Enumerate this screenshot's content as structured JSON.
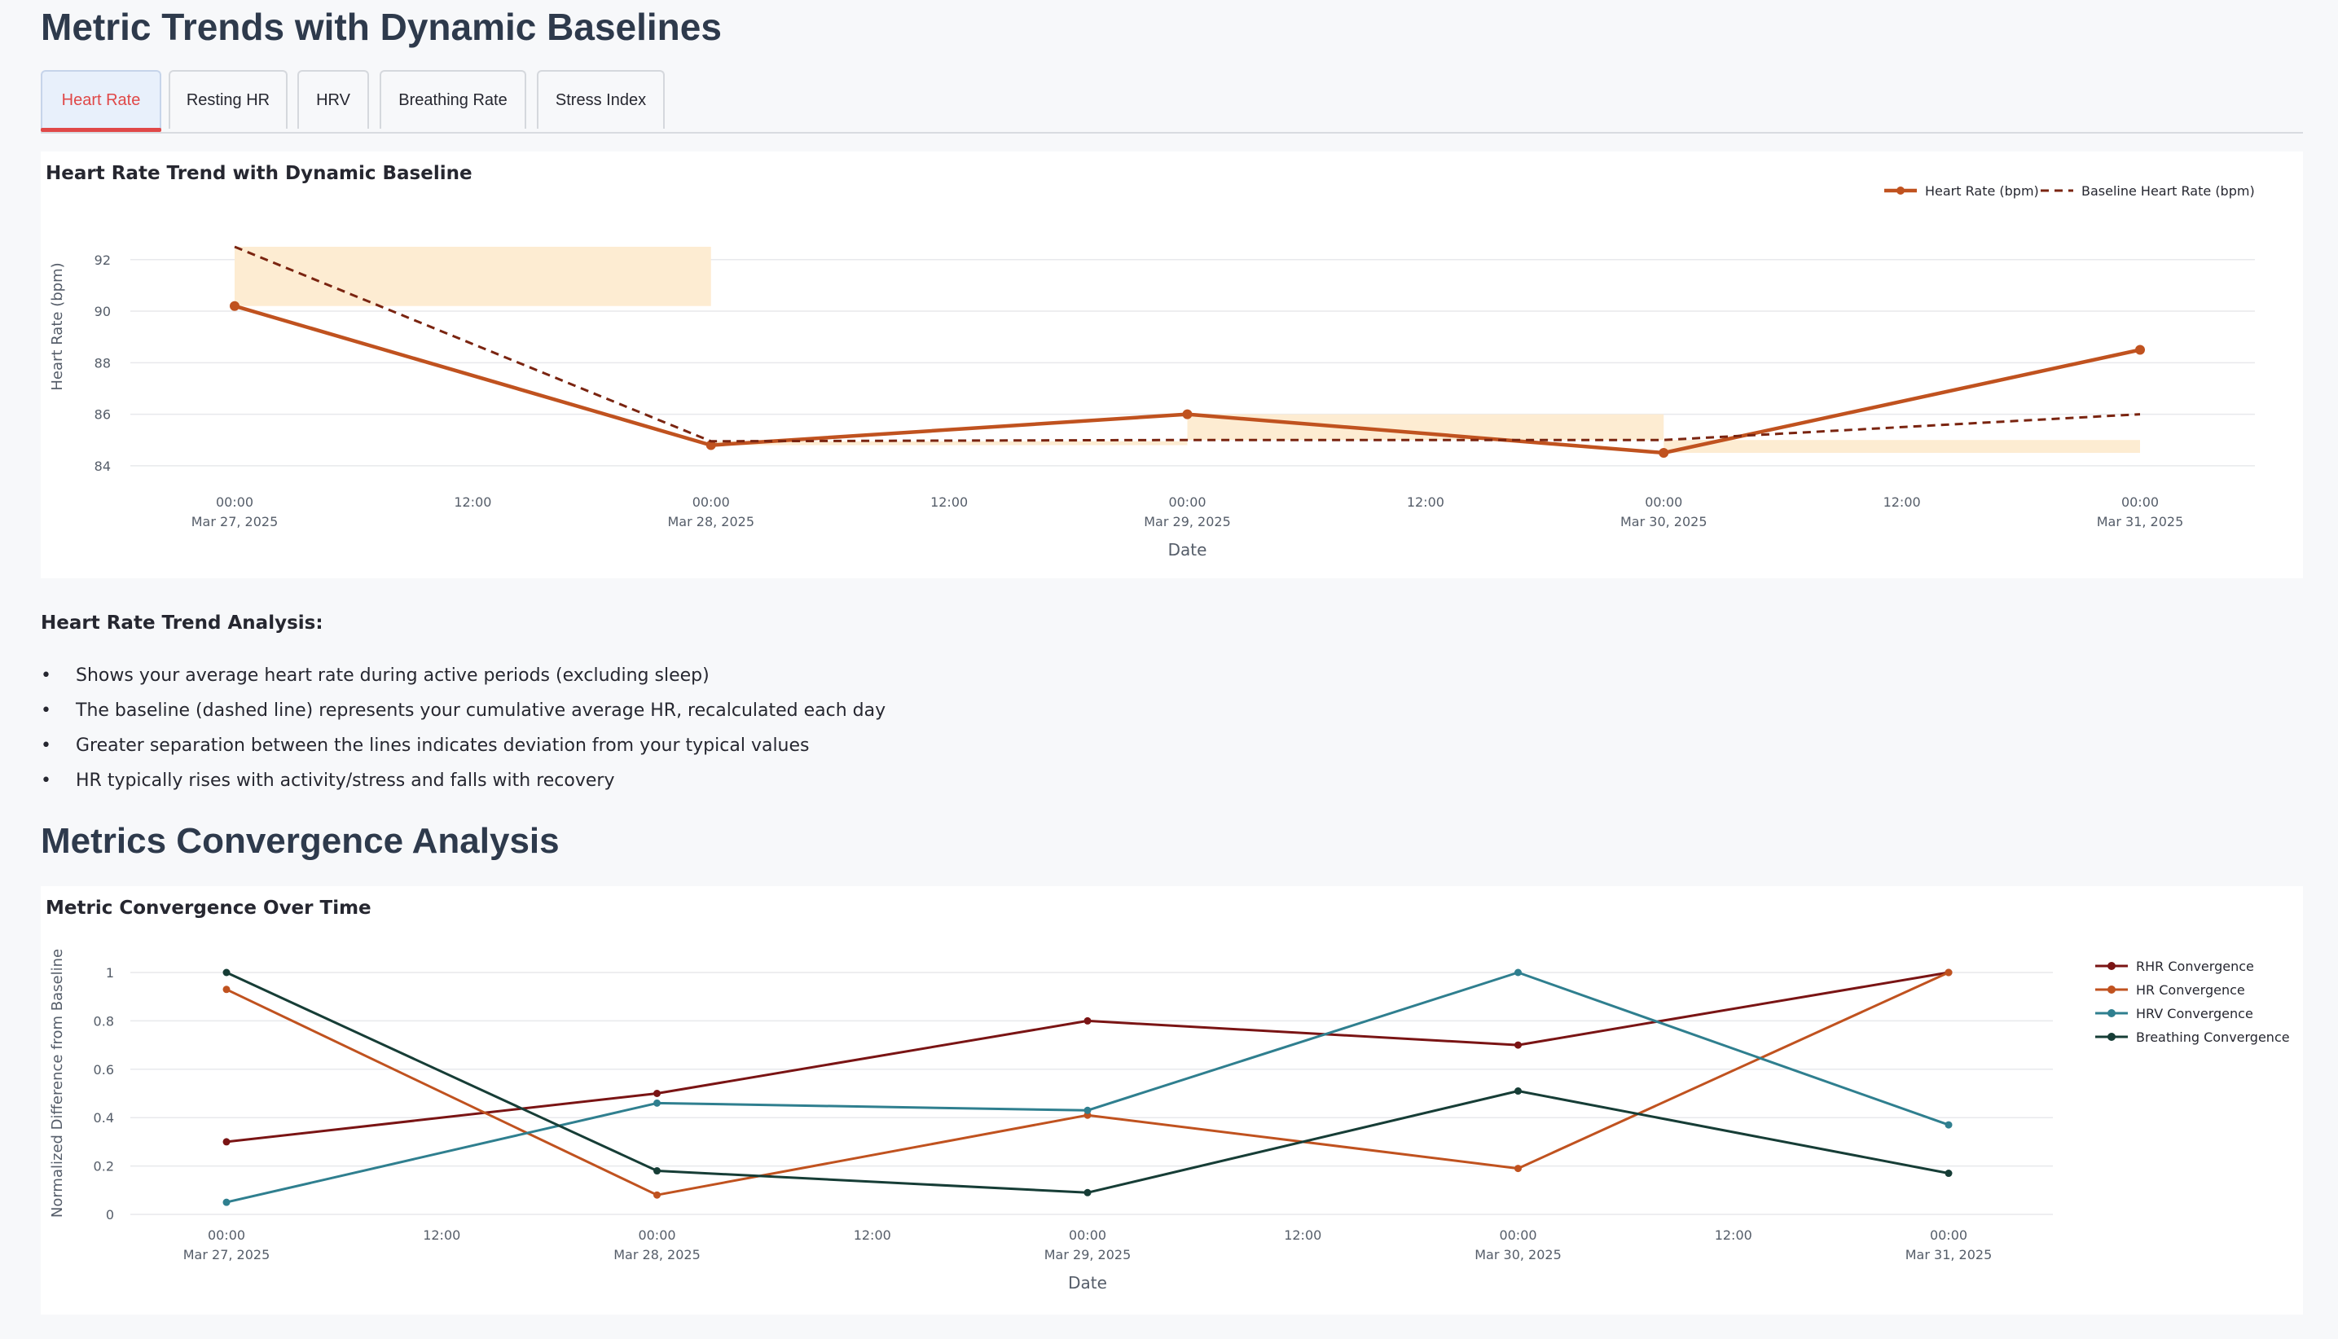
{
  "page": {
    "title": "Metric Trends with Dynamic Baselines",
    "tabs": [
      {
        "label": "Heart Rate",
        "active": true
      },
      {
        "label": "Resting HR",
        "active": false
      },
      {
        "label": "HRV",
        "active": false
      },
      {
        "label": "Breathing Rate",
        "active": false
      },
      {
        "label": "Stress Index",
        "active": false
      }
    ],
    "analysis_title": "Heart Rate Trend Analysis:",
    "analysis_points": [
      "Shows your average heart rate during active periods (excluding sleep)",
      "The baseline (dashed line) represents your cumulative average HR, recalculated each day",
      "Greater separation between the lines indicates deviation from your typical values",
      "HR typically rises with activity/stress and falls with recovery"
    ],
    "section2_title": "Metrics Convergence Analysis",
    "colors": {
      "accent": "#e04848",
      "heading": "#2e3a4c",
      "hr": "#c0521f",
      "baseline": "#7a2410",
      "band": "#fdecd2"
    }
  },
  "chart_data": [
    {
      "type": "line",
      "title": "Heart Rate Trend with Dynamic Baseline",
      "xlabel": "Date",
      "ylabel": "Heart Rate (bpm)",
      "x": [
        "2025-03-27",
        "2025-03-28",
        "2025-03-29",
        "2025-03-30",
        "2025-03-31"
      ],
      "x_ticks": [
        {
          "time": "00:00",
          "date": "Mar 27, 2025"
        },
        {
          "time": "12:00",
          "date": ""
        },
        {
          "time": "00:00",
          "date": "Mar 28, 2025"
        },
        {
          "time": "12:00",
          "date": ""
        },
        {
          "time": "00:00",
          "date": "Mar 29, 2025"
        },
        {
          "time": "12:00",
          "date": ""
        },
        {
          "time": "00:00",
          "date": "Mar 30, 2025"
        },
        {
          "time": "12:00",
          "date": ""
        },
        {
          "time": "00:00",
          "date": "Mar 31, 2025"
        }
      ],
      "y_ticks": [
        84,
        86,
        88,
        90,
        92
      ],
      "ylim": [
        83.3,
        93.1
      ],
      "grid": true,
      "legend_position": "top-right",
      "series": [
        {
          "name": "Heart Rate (bpm)",
          "values": [
            90.2,
            84.8,
            86.0,
            84.5,
            88.5
          ],
          "color": "#c0521f",
          "style": "solid",
          "markers": true
        },
        {
          "name": "Baseline Heart Rate (bpm)",
          "values": [
            92.5,
            84.95,
            85.0,
            85.0,
            86.0
          ],
          "color": "#7a2410",
          "style": "dashed",
          "markers": false
        }
      ],
      "deviation_bands": true
    },
    {
      "type": "line",
      "title": "Metric Convergence Over Time",
      "xlabel": "Date",
      "ylabel": "Normalized Difference from Baseline",
      "x": [
        "2025-03-27",
        "2025-03-28",
        "2025-03-29",
        "2025-03-30",
        "2025-03-31"
      ],
      "x_ticks": [
        {
          "time": "00:00",
          "date": "Mar 27, 2025"
        },
        {
          "time": "12:00",
          "date": ""
        },
        {
          "time": "00:00",
          "date": "Mar 28, 2025"
        },
        {
          "time": "12:00",
          "date": ""
        },
        {
          "time": "00:00",
          "date": "Mar 29, 2025"
        },
        {
          "time": "12:00",
          "date": ""
        },
        {
          "time": "00:00",
          "date": "Mar 30, 2025"
        },
        {
          "time": "12:00",
          "date": ""
        },
        {
          "time": "00:00",
          "date": "Mar 31, 2025"
        }
      ],
      "y_ticks": [
        0,
        0.2,
        0.4,
        0.6,
        0.8,
        1
      ],
      "ylim": [
        0,
        1
      ],
      "grid": true,
      "legend_position": "right",
      "series": [
        {
          "name": "RHR Convergence",
          "values": [
            0.3,
            0.5,
            0.8,
            0.7,
            1.0
          ],
          "color": "#7a1414"
        },
        {
          "name": "HR Convergence",
          "values": [
            0.93,
            0.08,
            0.41,
            0.19,
            1.0
          ],
          "color": "#c0521f"
        },
        {
          "name": "HRV Convergence",
          "values": [
            0.05,
            0.46,
            0.43,
            1.0,
            0.37
          ],
          "color": "#2f7f8f"
        },
        {
          "name": "Breathing Convergence",
          "values": [
            1.0,
            0.18,
            0.09,
            0.51,
            0.17
          ],
          "color": "#163d36"
        }
      ]
    }
  ]
}
